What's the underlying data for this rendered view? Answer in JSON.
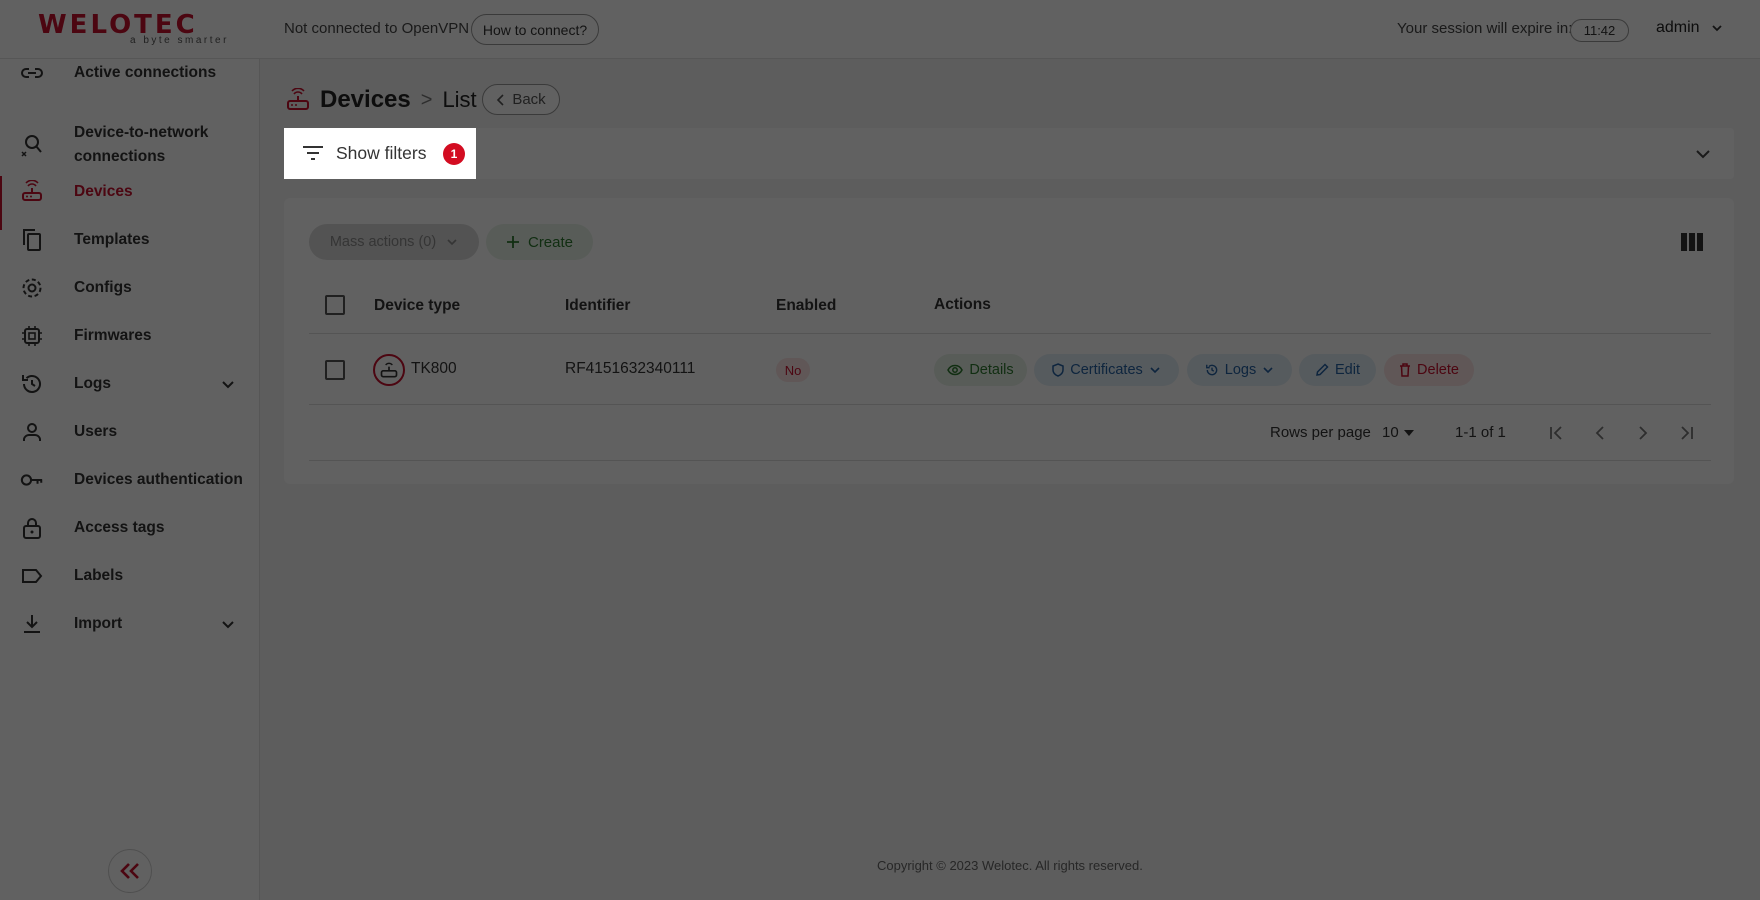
{
  "header": {
    "brand": "WELOTEC",
    "tagline": "a byte smarter",
    "vpn_status": "Not connected to OpenVPN",
    "how_to_connect": "How to connect?",
    "session_label": "Your session will expire in:",
    "session_time": "11:42",
    "user": "admin"
  },
  "sidebar": {
    "items": [
      {
        "label": "Active connections",
        "icon": "link-icon"
      },
      {
        "label": "Device-to-network connections",
        "icon": "network-search-icon"
      },
      {
        "label": "Devices",
        "icon": "router-icon",
        "active": true
      },
      {
        "label": "Templates",
        "icon": "copy-icon"
      },
      {
        "label": "Configs",
        "icon": "gear-icon"
      },
      {
        "label": "Firmwares",
        "icon": "chip-icon"
      },
      {
        "label": "Logs",
        "icon": "history-icon",
        "expandable": true
      },
      {
        "label": "Users",
        "icon": "user-icon"
      },
      {
        "label": "Devices authentication",
        "icon": "key-icon"
      },
      {
        "label": "Access tags",
        "icon": "lock-icon"
      },
      {
        "label": "Labels",
        "icon": "label-icon"
      },
      {
        "label": "Import",
        "icon": "download-icon",
        "expandable": true
      }
    ],
    "collapse_icon": "double-chevron-left-icon"
  },
  "breadcrumb": {
    "section": "Devices",
    "separator": ">",
    "page": "List",
    "back": "Back"
  },
  "filters": {
    "label": "Show filters",
    "count": "1"
  },
  "toolbar": {
    "mass_actions": "Mass actions (0)",
    "create": "Create"
  },
  "table": {
    "columns": [
      "Device type",
      "Identifier",
      "Enabled",
      "Actions"
    ],
    "rows": [
      {
        "device_type": "TK800",
        "identifier": "RF4151632340111",
        "enabled": "No",
        "actions": [
          "Details",
          "Certificates",
          "Logs",
          "Edit",
          "Delete"
        ]
      }
    ]
  },
  "pagination": {
    "rows_per_page_label": "Rows per page",
    "rows_per_page": "10",
    "range": "1-1 of 1"
  },
  "footer": {
    "copyright": "Copyright © 2023 Welotec. All rights reserved."
  },
  "colors": {
    "brand": "#c8102e",
    "success": "#2f7a30",
    "info": "#2663a3"
  }
}
